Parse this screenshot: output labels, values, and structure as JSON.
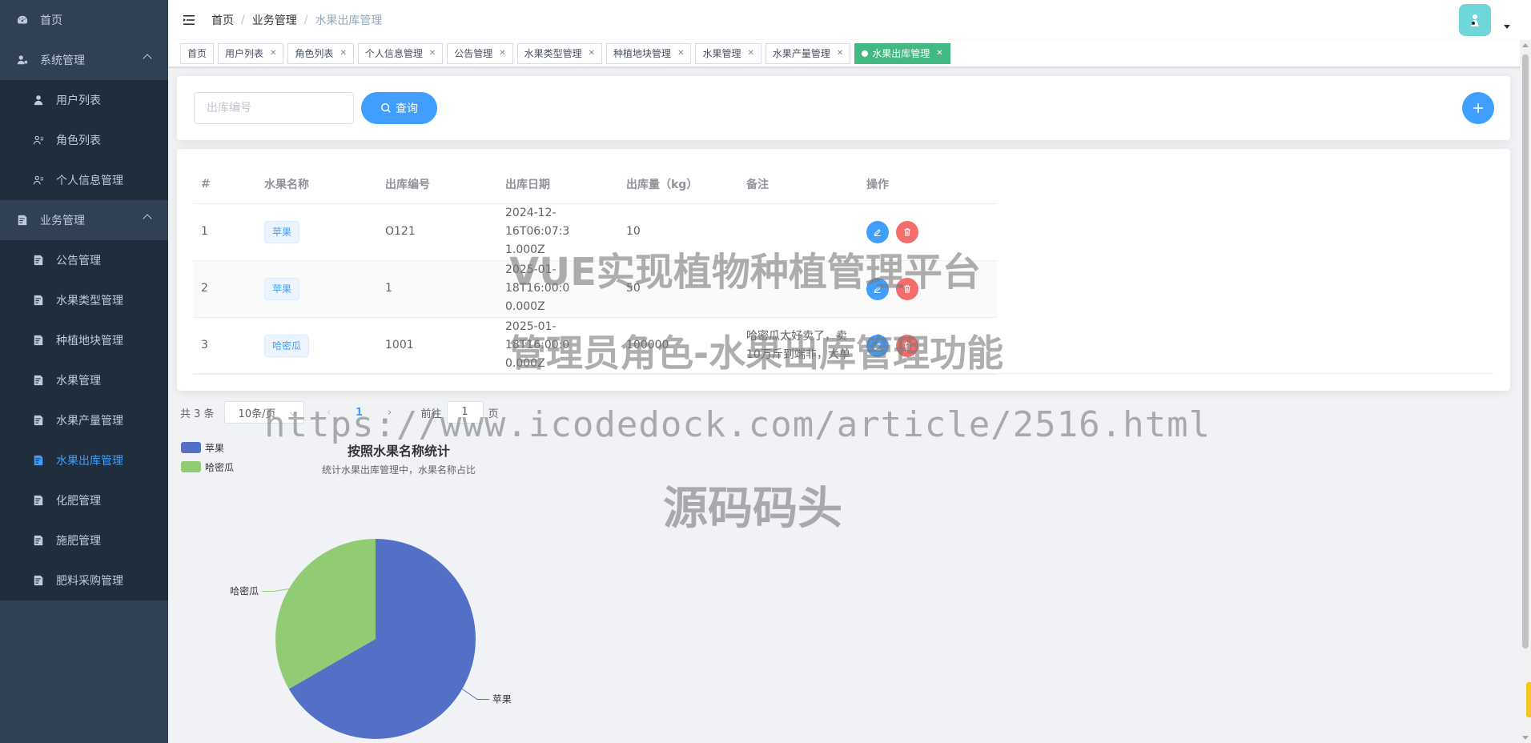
{
  "sidebar": {
    "home": "首页",
    "system": {
      "label": "系统管理",
      "items": [
        "用户列表",
        "角色列表",
        "个人信息管理"
      ]
    },
    "business": {
      "label": "业务管理",
      "items": [
        "公告管理",
        "水果类型管理",
        "种植地块管理",
        "水果管理",
        "水果产量管理",
        "水果出库管理",
        "化肥管理",
        "施肥管理",
        "肥料采购管理"
      ],
      "active_index": 5
    }
  },
  "header": {
    "breadcrumb": [
      "首页",
      "业务管理",
      "水果出库管理"
    ]
  },
  "tags": [
    {
      "label": "首页",
      "closable": false
    },
    {
      "label": "用户列表",
      "closable": true
    },
    {
      "label": "角色列表",
      "closable": true
    },
    {
      "label": "个人信息管理",
      "closable": true
    },
    {
      "label": "公告管理",
      "closable": true
    },
    {
      "label": "水果类型管理",
      "closable": true
    },
    {
      "label": "种植地块管理",
      "closable": true
    },
    {
      "label": "水果管理",
      "closable": true
    },
    {
      "label": "水果产量管理",
      "closable": true
    },
    {
      "label": "水果出库管理",
      "closable": true,
      "active": true
    }
  ],
  "search": {
    "placeholder": "出库编号",
    "query_label": "查询"
  },
  "table": {
    "columns": [
      "#",
      "水果名称",
      "出库编号",
      "出库日期",
      "出库量（kg）",
      "备注",
      "操作"
    ],
    "rows": [
      {
        "index": "1",
        "fruit": "苹果",
        "code": "O121",
        "date_line1": "2024-12-16T06:07:3",
        "date_line2": "1.000Z",
        "qty": "10",
        "remark_line1": "",
        "remark_line2": ""
      },
      {
        "index": "2",
        "fruit": "苹果",
        "code": "1",
        "date_line1": "2025-01-18T16:00:0",
        "date_line2": "0.000Z",
        "qty": "50",
        "remark_line1": "",
        "remark_line2": ""
      },
      {
        "index": "3",
        "fruit": "哈密瓜",
        "code": "1001",
        "date_line1": "2025-01-18T16:00:0",
        "date_line2": "0.000Z",
        "qty": "100000",
        "remark_line1": "哈密瓜太好卖了，卖",
        "remark_line2": "10万斤到端非，大单"
      }
    ]
  },
  "pagination": {
    "total": "共 3 条",
    "page_size": "10条/页",
    "current_page": "1",
    "goto_label": "前往",
    "goto_value": "1",
    "page_suffix": "页"
  },
  "chart_data": {
    "type": "pie",
    "title": "按照水果名称统计",
    "subtitle": "统计水果出库管理中，水果名称占比",
    "categories": [
      "苹果",
      "哈密瓜"
    ],
    "values": [
      2,
      1
    ],
    "colors": [
      "#5470c6",
      "#91cc75"
    ],
    "legend_placement": "top-left"
  },
  "watermark": {
    "line1": "VUE实现植物种植管理平台",
    "line2": "管理员角色-水果出库管理功能",
    "line3": "https://www.icodedock.com/article/2516.html",
    "line4": "源码码头"
  }
}
